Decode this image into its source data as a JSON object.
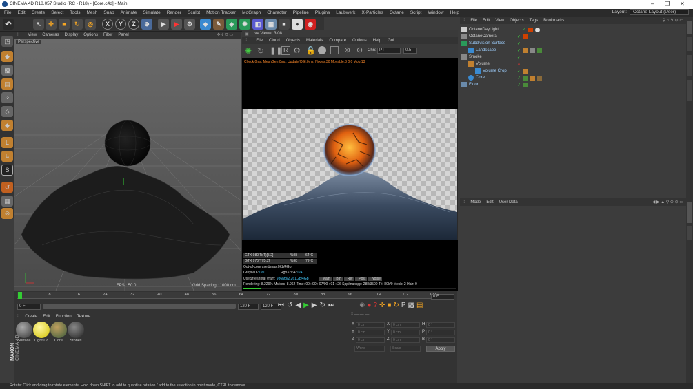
{
  "window": {
    "title": "CINEMA 4D R18.057 Studio (RC - R18) - [Core.c4d] - Main",
    "minimize": "–",
    "restore": "❐",
    "close": "✕"
  },
  "menu": [
    "File",
    "Edit",
    "Create",
    "Select",
    "Tools",
    "Mesh",
    "Snap",
    "Animate",
    "Simulate",
    "Render",
    "Sculpt",
    "Motion Tracker",
    "MoGraph",
    "Character",
    "Pipeline",
    "Plugins",
    "Laubwerk",
    "X-Particles",
    "Octane",
    "Script",
    "Window",
    "Help"
  ],
  "layout": {
    "label": "Layout:",
    "value": "Octane Layout (User)"
  },
  "toolbar": {
    "x": "X",
    "y": "Y",
    "z": "Z"
  },
  "viewport": {
    "menu": [
      "View",
      "Cameras",
      "Display",
      "Options",
      "Filter",
      "Panel"
    ],
    "name": "Perspective",
    "fps": "FPS : 50.0",
    "grid": "Grid Spacing : 1000 cm"
  },
  "liveviewer": {
    "title": "Live Viewer 3.08",
    "menu": [
      "File",
      "Cloud",
      "Objects",
      "Materials",
      "Compare",
      "Options",
      "Help",
      "Gui"
    ],
    "chn_label": "Chn:",
    "chn_value": "PT",
    "exposure": "0.5",
    "status": "Check:0ms. MeshGen:0ms. Update[CG]:0ms. Nodes:30 Movable:3  0 0 Mob:13",
    "gpu1": {
      "name": "GTX 980 Ti(T)[5.2]",
      "pct": "%98",
      "temp": "64°C"
    },
    "gpu2": {
      "name": "GTX 970(T)[5.2]",
      "pct": "%98",
      "temp": "79°C"
    },
    "ooc": "Out-of-core used/max:0Kb/4Gb",
    "grey_label": "Grey8/16:",
    "grey_value": "0/0",
    "rgb_label": "Rgb32/64:",
    "rgb_value": "0/4",
    "vram_label": "Used/free/total vram:",
    "vram_value": "986Mb/2.261Gb/4Gb",
    "passes": [
      "_Main",
      "_Bth",
      "_Ref",
      "_Post",
      "_Noise"
    ],
    "render_line": "Rendering: 8.229%  Ms/sec: 8.962  Time: 00 : 00 : 07/00 : 01 : 26  Spp/maxspp: 288/3500  Tri: 80k/0  Mesh: 2  Hair: 0",
    "progress": 0.08229
  },
  "timeline": {
    "ticks": [
      "0",
      "8",
      "16",
      "24",
      "32",
      "40",
      "48",
      "56",
      "64",
      "72",
      "80",
      "88",
      "96",
      "104",
      "112",
      "120"
    ],
    "current": "0 F",
    "start": "0 F",
    "end": "120 F",
    "end2": "120 F"
  },
  "materials": {
    "menu": [
      "Create",
      "Edit",
      "Function",
      "Texture"
    ],
    "items": [
      {
        "label": "Surface",
        "color": "#5a5a5a"
      },
      {
        "label": "Light Cc",
        "color": "#f0e000"
      },
      {
        "label": "Core",
        "color": "#6a5a3a"
      },
      {
        "label": "Stones",
        "color": "#4a4a4a"
      }
    ]
  },
  "coords": {
    "rows": [
      {
        "a": "X",
        "av": "0 cm",
        "b": "X",
        "bv": "0 cm",
        "c": "H",
        "cv": "0 °"
      },
      {
        "a": "Y",
        "av": "0 cm",
        "b": "Y",
        "bv": "0 cm",
        "c": "P",
        "cv": "0 °"
      },
      {
        "a": "Z",
        "av": "0 cm",
        "b": "Z",
        "bv": "0 cm",
        "c": "B",
        "cv": "0 °"
      }
    ],
    "world": "World",
    "scale": "Scale",
    "apply": "Apply"
  },
  "objects": {
    "menu": [
      "File",
      "Edit",
      "View",
      "Objects",
      "Tags",
      "Bookmarks"
    ],
    "rows": [
      {
        "name": "OctaneDayLight",
        "indent": 0,
        "color": "#d0d0d0"
      },
      {
        "name": "OctaneCamera",
        "indent": 0,
        "color": "#d0d0d0"
      },
      {
        "name": "Subdivision Surface",
        "indent": 0,
        "color": "#9fd0ff"
      },
      {
        "name": "Landscape",
        "indent": 1,
        "color": "#9fd0ff"
      },
      {
        "name": "Smoke",
        "indent": 0,
        "color": "#d0d0d0"
      },
      {
        "name": "Volume",
        "indent": 1,
        "color": "#d0d0d0"
      },
      {
        "name": "Volume Crop",
        "indent": 2,
        "color": "#9fd0ff"
      },
      {
        "name": "Core",
        "indent": 1,
        "color": "#9fd0ff"
      },
      {
        "name": "Floor",
        "indent": 0,
        "color": "#9fd0ff"
      }
    ]
  },
  "attributes": {
    "menu": [
      "Mode",
      "Edit",
      "User Data"
    ]
  },
  "logo": {
    "top": "MAXON",
    "bottom": "CINEMA 4D"
  },
  "statusbar": "Rotate: Click and drag to rotate elements. Hold down SHIFT to add to quantize rotation / add to the selection in point mode, CTRL to remove."
}
